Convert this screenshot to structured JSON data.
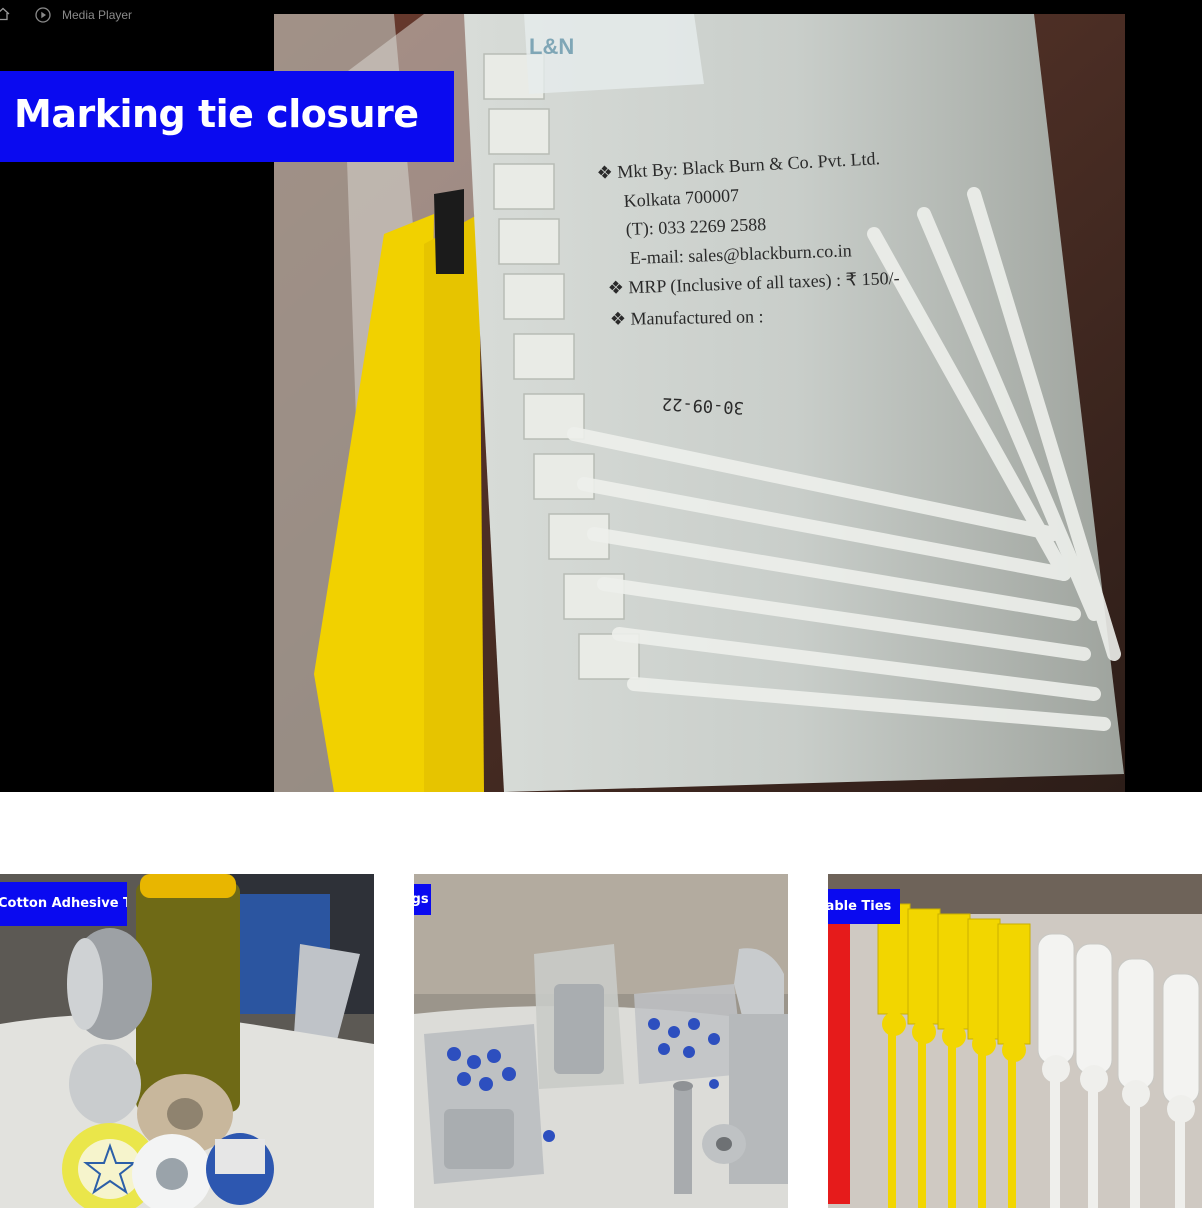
{
  "player": {
    "app_name": "Media Player",
    "icons": [
      "home-icon",
      "play-circle-icon"
    ],
    "video_title": "Marking tie closure",
    "bag_label": {
      "line1": "❖ Mkt By: Black Burn & Co. Pvt. Ltd.",
      "line2": "Kolkata 700007",
      "line3": "(T): 033 2269 2588",
      "line4": "E-mail: sales@blackburn.co.in",
      "line5": "❖ MRP (Inclusive of all taxes) : ₹ 150/-",
      "line6": "❖ Manufactured on :",
      "date": "30-09-22"
    },
    "accent_color": "#0a0af0"
  },
  "products": [
    {
      "tag": "Cotton Adhesive Tapes"
    },
    {
      "tag": "Lugs"
    },
    {
      "tag": "Cable Ties"
    }
  ]
}
